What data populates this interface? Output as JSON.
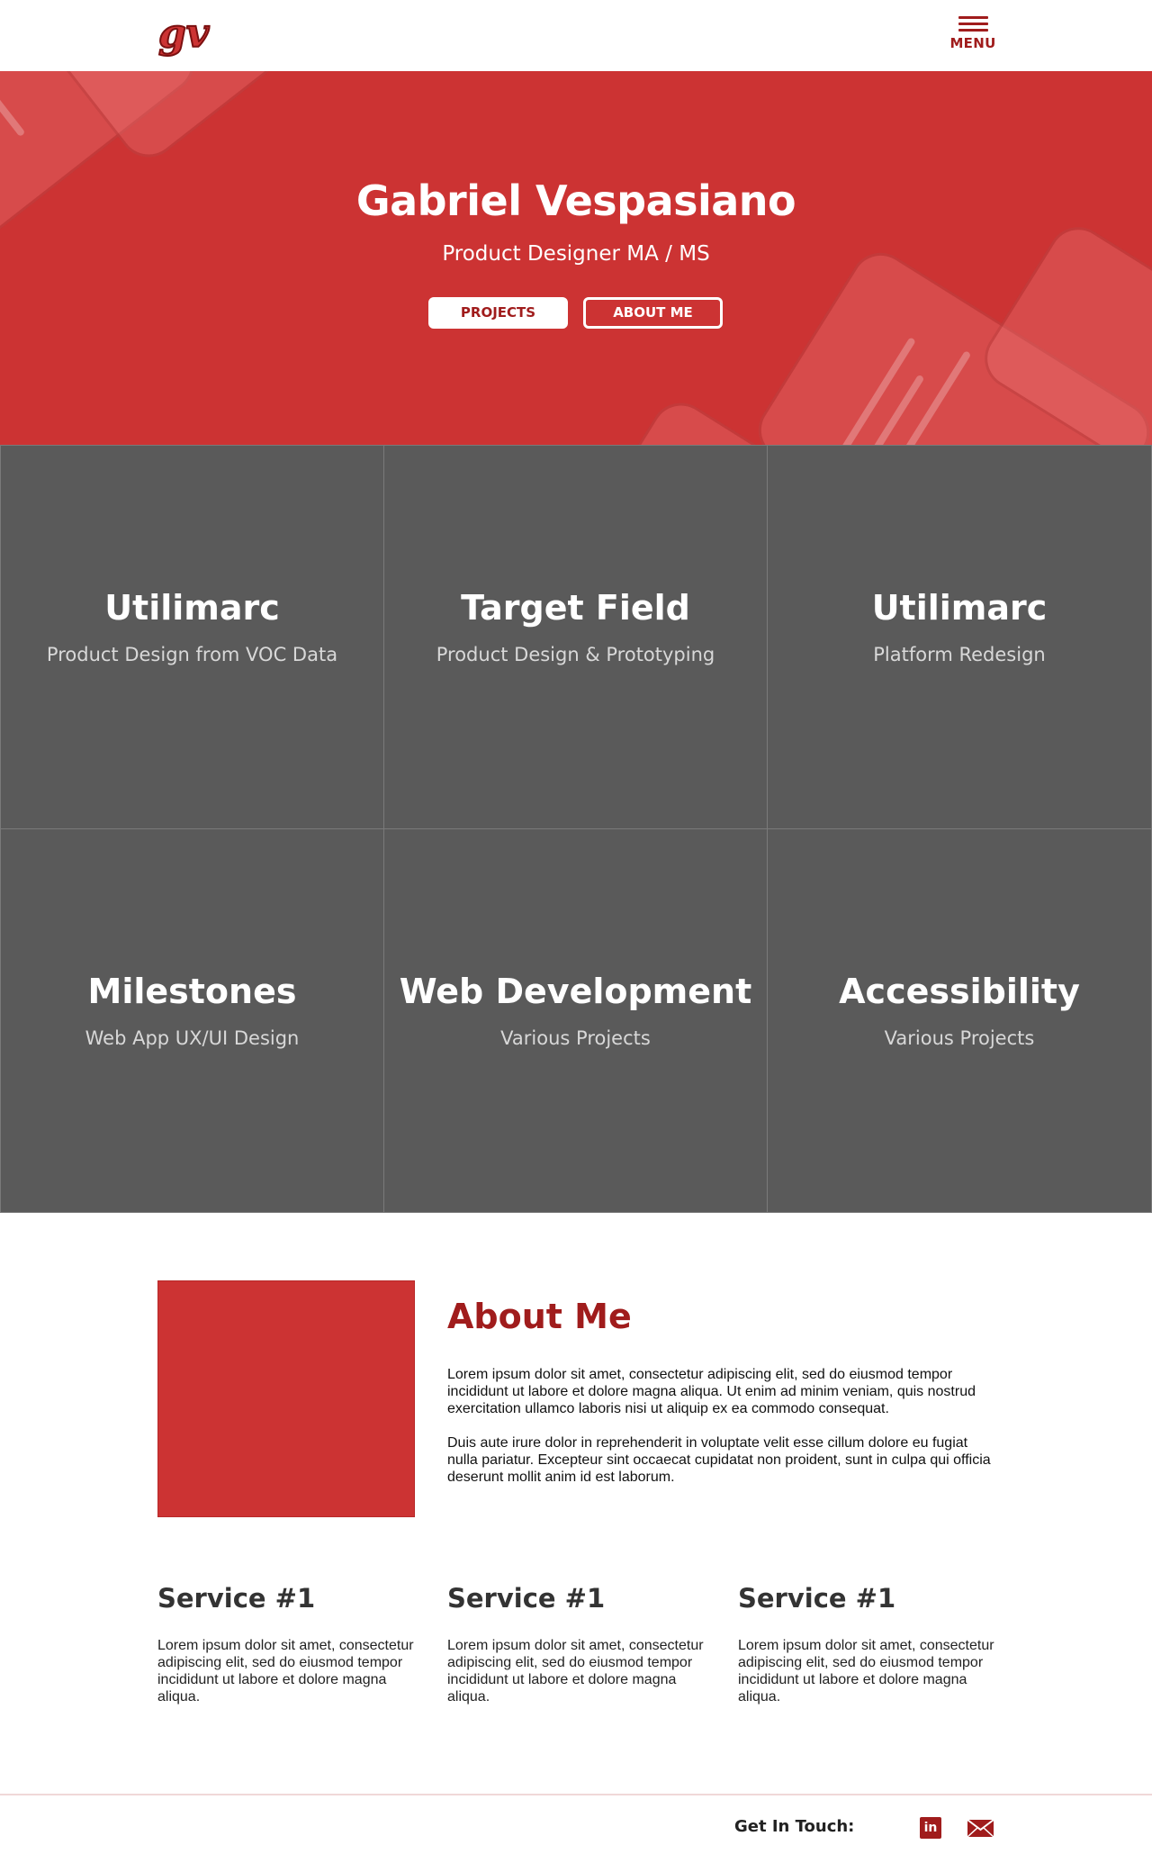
{
  "header": {
    "logo_text": "gv",
    "menu_label": "MENU"
  },
  "hero": {
    "name": "Gabriel Vespasiano",
    "subtitle": "Product Designer MA / MS",
    "projects_button": "PROJECTS",
    "about_button": "ABOUT ME"
  },
  "projects": [
    {
      "title": "Utilimarc",
      "subtitle": "Product Design from VOC Data"
    },
    {
      "title": "Target Field",
      "subtitle": "Product Design & Prototyping"
    },
    {
      "title": "Utilimarc",
      "subtitle": "Platform Redesign"
    },
    {
      "title": "Milestones",
      "subtitle": "Web App UX/UI Design"
    },
    {
      "title": "Web Development",
      "subtitle": "Various Projects"
    },
    {
      "title": "Accessibility",
      "subtitle": "Various Projects"
    }
  ],
  "about": {
    "title": "About Me",
    "paragraph1": "Lorem ipsum dolor sit amet, consectetur adipiscing elit, sed do eiusmod tempor incididunt ut labore et dolore magna aliqua. Ut enim ad minim veniam, quis nostrud exercitation ullamco laboris nisi ut aliquip ex ea commodo consequat.",
    "paragraph2": "Duis aute irure dolor in reprehenderit in voluptate velit esse cillum dolore eu fugiat nulla pariatur. Excepteur sint occaecat cupidatat non proident, sunt in culpa qui officia deserunt mollit anim id est laborum."
  },
  "services": [
    {
      "title": "Service #1",
      "text": "Lorem ipsum dolor sit amet, consectetur adipiscing elit, sed do eiusmod tempor incididunt ut labore et dolore magna aliqua."
    },
    {
      "title": "Service #1",
      "text": "Lorem ipsum dolor sit amet, consectetur adipiscing elit, sed do eiusmod tempor incididunt ut labore et dolore magna aliqua."
    },
    {
      "title": "Service #1",
      "text": "Lorem ipsum dolor sit amet, consectetur adipiscing elit, sed do eiusmod tempor incididunt ut labore et dolore magna aliqua."
    }
  ],
  "footer": {
    "get_in_touch": "Get In Touch:",
    "linkedin_icon": "linkedin-icon",
    "mail_icon": "mail-icon"
  },
  "colors": {
    "brand_red": "#cc3333",
    "dark_red": "#a01c1c",
    "tile_gray": "#5a5a5a"
  }
}
